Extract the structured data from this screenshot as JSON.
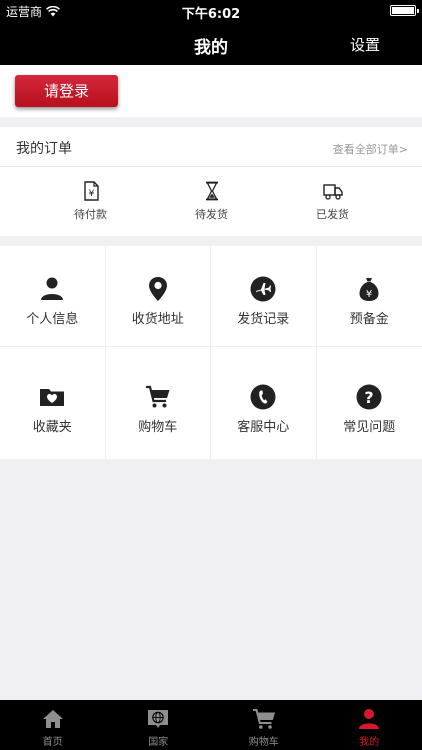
{
  "status_bar": {
    "carrier": "运营商",
    "time": "下午6:02"
  },
  "navbar": {
    "title": "我的",
    "settings": "设置"
  },
  "login": {
    "button_label": "请登录"
  },
  "orders": {
    "title": "我的订单",
    "view_all": "查看全部订单>",
    "items": [
      {
        "label": "待付款",
        "icon": "pending-payment-icon"
      },
      {
        "label": "待发货",
        "icon": "hourglass-icon"
      },
      {
        "label": "已发货",
        "icon": "truck-icon"
      }
    ]
  },
  "grid": {
    "items": [
      {
        "label": "个人信息",
        "icon": "person-icon"
      },
      {
        "label": "收货地址",
        "icon": "location-pin-icon"
      },
      {
        "label": "发货记录",
        "icon": "airplane-icon"
      },
      {
        "label": "预备金",
        "icon": "money-bag-icon"
      },
      {
        "label": "收藏夹",
        "icon": "favorites-folder-icon"
      },
      {
        "label": "购物车",
        "icon": "shopping-cart-icon"
      },
      {
        "label": "客服中心",
        "icon": "phone-icon"
      },
      {
        "label": "常见问题",
        "icon": "question-icon"
      }
    ]
  },
  "tabbar": {
    "items": [
      {
        "label": "首页",
        "icon": "home-icon",
        "active": false
      },
      {
        "label": "国家",
        "icon": "globe-icon",
        "active": false
      },
      {
        "label": "购物车",
        "icon": "shopping-cart-icon",
        "active": false
      },
      {
        "label": "我的",
        "icon": "person-icon",
        "active": true
      }
    ]
  },
  "colors": {
    "accent": "#d7172a",
    "header": "#000000",
    "background": "#efeff4"
  }
}
